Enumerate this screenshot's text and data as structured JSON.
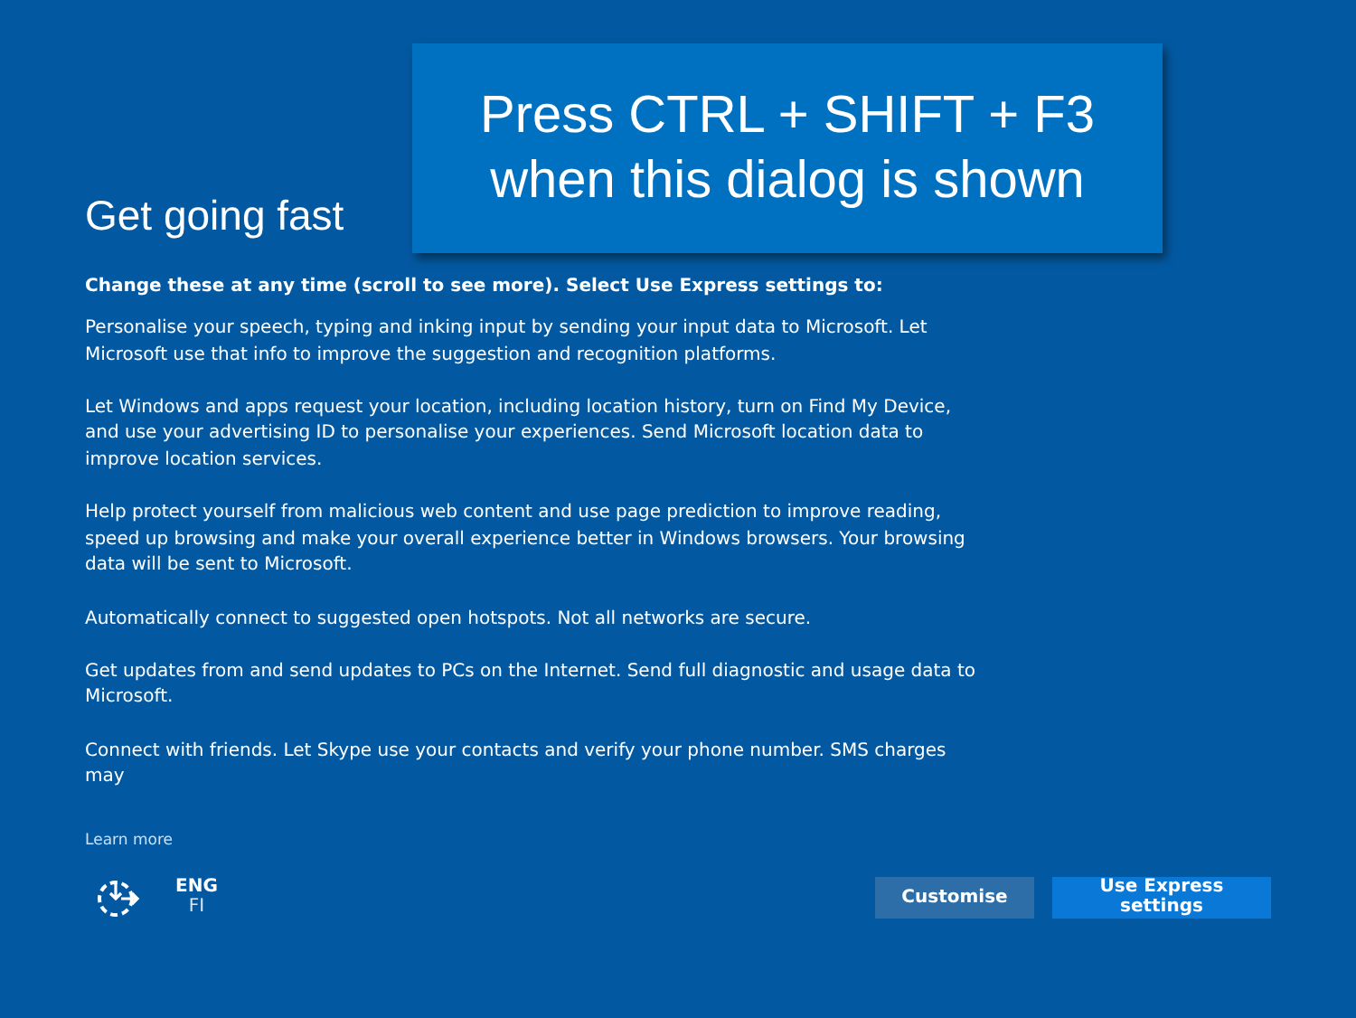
{
  "title": "Get going fast",
  "intro": "Change these at any time (scroll to see more). Select Use Express settings to:",
  "paragraphs": [
    "Personalise your speech, typing and inking input by sending your input data to Microsoft. Let Microsoft use that info to improve the suggestion and recognition platforms.",
    "Let Windows and apps request your location, including location history, turn on Find My Device, and use your advertising ID to personalise your experiences. Send Microsoft location data to improve location services.",
    "Help protect yourself from malicious web content and use page prediction to improve reading, speed up browsing and make your overall experience better in Windows browsers. Your browsing data will be sent to Microsoft.",
    "Automatically connect to suggested open hotspots. Not all networks are secure.",
    "Get updates from and send updates to PCs on the Internet. Send full diagnostic and usage data to Microsoft.",
    "Connect with friends. Let Skype use your contacts and verify your phone number. SMS charges may"
  ],
  "learn_more": "Learn more",
  "language": {
    "code": "ENG",
    "layout": "FI"
  },
  "buttons": [
    {
      "label": "Customise",
      "kind": "secondary"
    },
    {
      "label": "Use Express settings",
      "kind": "primary"
    }
  ],
  "callout": "Press CTRL + SHIFT + F3 when this dialog is shown"
}
